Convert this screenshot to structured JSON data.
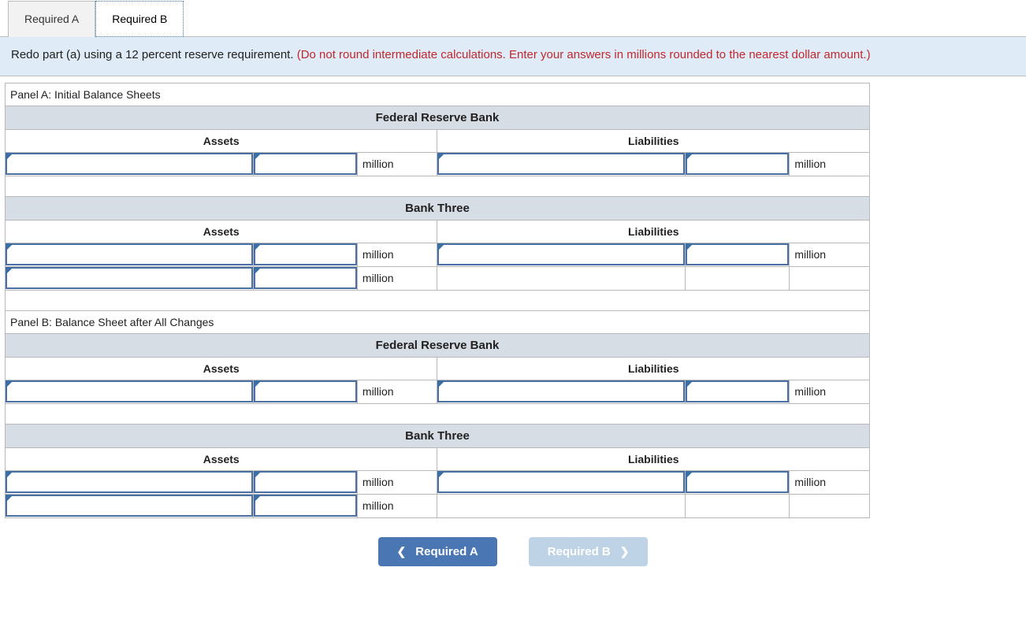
{
  "tabs": {
    "a": "Required A",
    "b": "Required B"
  },
  "instruction": {
    "main": "Redo part (a) using a 12 percent reserve requirement. ",
    "hint": "(Do not round intermediate calculations. Enter your answers in millions rounded to the nearest dollar amount.)"
  },
  "labels": {
    "panelA": "Panel A: Initial Balance Sheets",
    "panelB": "Panel B: Balance Sheet after All Changes",
    "frb": "Federal Reserve Bank",
    "bank3": "Bank Three",
    "assets": "Assets",
    "liabilities": "Liabilities",
    "unit": "million"
  },
  "nav": {
    "prev": "Required A",
    "next": "Required B"
  },
  "inputs": {
    "a_frb_a_name": "",
    "a_frb_a_amt": "",
    "a_frb_l_name": "",
    "a_frb_l_amt": "",
    "a_b3_a1_name": "",
    "a_b3_a1_amt": "",
    "a_b3_a2_name": "",
    "a_b3_a2_amt": "",
    "a_b3_l1_name": "",
    "a_b3_l1_amt": "",
    "b_frb_a_name": "",
    "b_frb_a_amt": "",
    "b_frb_l_name": "",
    "b_frb_l_amt": "",
    "b_b3_a1_name": "",
    "b_b3_a1_amt": "",
    "b_b3_a2_name": "",
    "b_b3_a2_amt": "",
    "b_b3_l1_name": "",
    "b_b3_l1_amt": ""
  }
}
